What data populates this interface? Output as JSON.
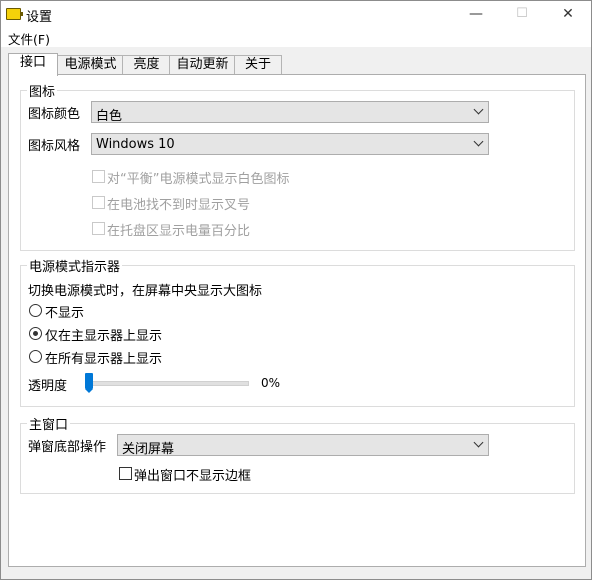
{
  "window": {
    "title": "设置",
    "controls": {
      "minimize": "—",
      "maximize": "☐",
      "close": "✕"
    }
  },
  "menu": {
    "file": "文件(F)"
  },
  "tabs": [
    "接口",
    "电源模式",
    "亮度",
    "自动更新",
    "关于"
  ],
  "active_tab": 0,
  "icon_group": {
    "legend": "图标",
    "color_label": "图标颜色",
    "color_value": "白色",
    "style_label": "图标风格",
    "style_value": "Windows 10",
    "options": [
      {
        "label": "对“平衡”电源模式显示白色图标",
        "checked": false,
        "disabled": true
      },
      {
        "label": "在电池找不到时显示叉号",
        "checked": false,
        "disabled": true
      },
      {
        "label": "在托盘区显示电量百分比",
        "checked": false,
        "disabled": true
      }
    ]
  },
  "indicator_group": {
    "legend": "电源模式指示器",
    "description": "切换电源模式时，在屏幕中央显示大图标",
    "options": [
      {
        "label": "不显示",
        "selected": false
      },
      {
        "label": "仅在主显示器上显示",
        "selected": true
      },
      {
        "label": "在所有显示器上显示",
        "selected": false
      }
    ],
    "opacity_label": "透明度",
    "opacity_value": "0%",
    "opacity_fraction": 0
  },
  "main_window_group": {
    "legend": "主窗口",
    "action_label": "弹窗底部操作",
    "action_value": "关闭屏幕",
    "borderless_label": "弹出窗口不显示边框",
    "borderless_checked": false
  },
  "colors": {
    "accent": "#0078d7",
    "disabled_text": "#a0a0a0"
  }
}
